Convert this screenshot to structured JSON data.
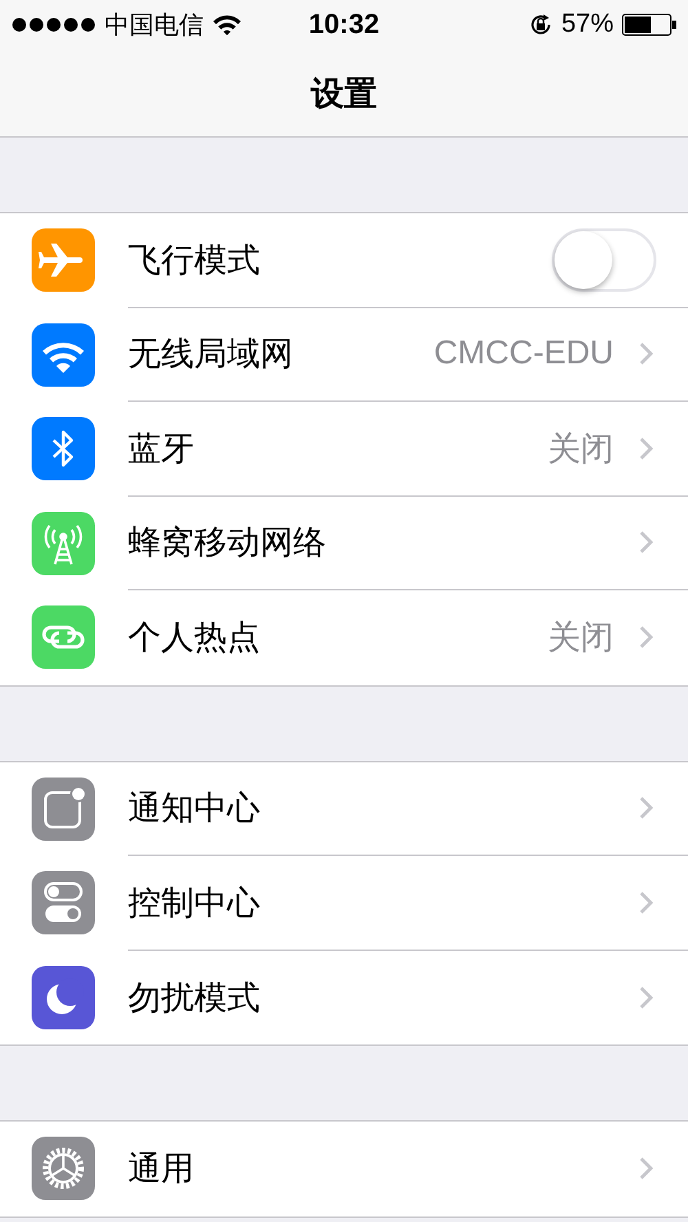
{
  "status_bar": {
    "carrier": "中国电信",
    "time": "10:32",
    "battery": "57%"
  },
  "nav": {
    "title": "设置"
  },
  "groups": [
    {
      "items": [
        {
          "kind": "toggle",
          "color": "#ff9500",
          "label": "飞行模式",
          "on": false
        },
        {
          "kind": "link",
          "color": "#007aff",
          "label": "无线局域网",
          "value": "CMCC-EDU"
        },
        {
          "kind": "link",
          "color": "#007aff",
          "label": "蓝牙",
          "value": "关闭"
        },
        {
          "kind": "link",
          "color": "#4cd964",
          "label": "蜂窝移动网络"
        },
        {
          "kind": "link",
          "color": "#4cd964",
          "label": "个人热点",
          "value": "关闭"
        }
      ]
    },
    {
      "items": [
        {
          "kind": "link",
          "color": "#8e8e93",
          "label": "通知中心"
        },
        {
          "kind": "link",
          "color": "#8e8e93",
          "label": "控制中心"
        },
        {
          "kind": "link",
          "color": "#5856d6",
          "label": "勿扰模式"
        }
      ]
    },
    {
      "items": [
        {
          "kind": "link",
          "color": "#8e8e93",
          "label": "通用"
        }
      ]
    }
  ]
}
